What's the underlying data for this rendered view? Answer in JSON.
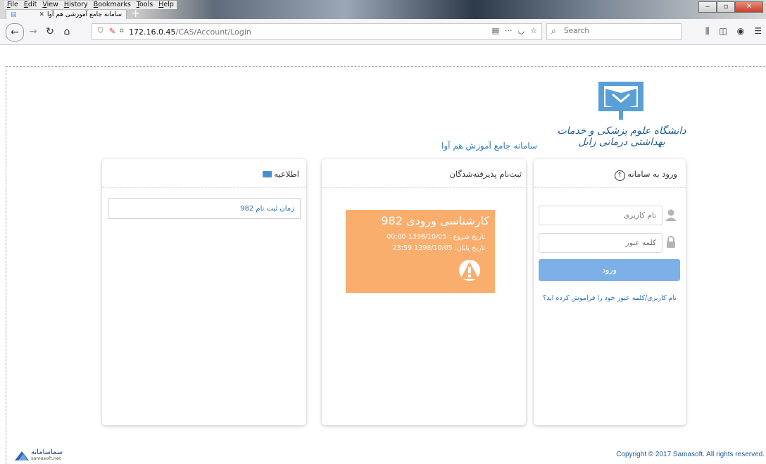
{
  "browser": {
    "menu": [
      "File",
      "Edit",
      "View",
      "History",
      "Bookmarks",
      "Tools",
      "Help"
    ],
    "tab_title": "سامانه جامع آموزشی هم آوا",
    "url_host": "172.16.0.45",
    "url_path": "/CAS/Account/Login",
    "search_placeholder": "Search"
  },
  "header": {
    "university_name": "دانشگاه علوم پزشکی و خدمات بهداشتی درمانی زابل",
    "system_name": "سامانه جامع آموزش هم آوا"
  },
  "login": {
    "title": "ورود به سامانه",
    "username_placeholder": "نام کاربری",
    "password_placeholder": "کلمه عبور",
    "submit_label": "ورود",
    "forgot_link": "نام کاربری/کلمه عبور خود را فراموش کرده اید؟"
  },
  "registration": {
    "title": "ثبت‌نام پذیرفته‌شدگان",
    "box_title": "کارشناسی ورودی 982",
    "start": "تاریخ شروع : 1398/10/05 00:00",
    "end": "تاریخ پایان: 1398/10/05 23:59"
  },
  "news": {
    "title": "اطلاعیه",
    "items": [
      "زمان ثبت نام 982"
    ]
  },
  "footer": {
    "brand_fa": "سماسامانه",
    "brand_en": "samasoft.net",
    "copyright": "Copyright © 2017 Samasoft. All rights reserved."
  },
  "colors": {
    "accent": "#7db0e6",
    "orange_box": "#f9ae6e",
    "link": "#2a6fb5"
  }
}
